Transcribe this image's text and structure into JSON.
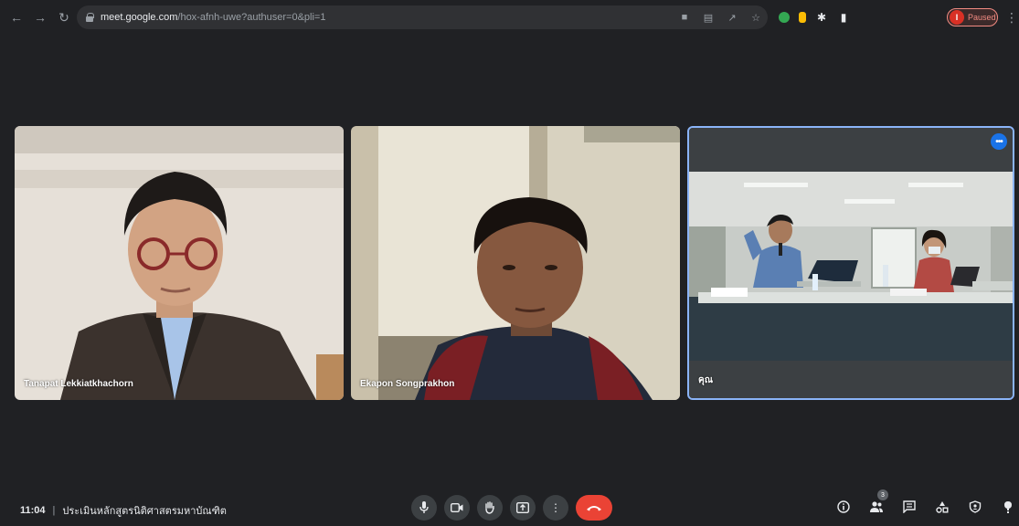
{
  "browser": {
    "url_host": "meet.google.com",
    "url_path": "/hox-afnh-uwe?authuser=0&pli=1",
    "profile_initial": "I",
    "profile_status": "Paused"
  },
  "participants": [
    {
      "name": "Tanapat Lekkiatkhachorn"
    },
    {
      "name": "Ekapon Songprakhon"
    },
    {
      "name": "คุณ"
    }
  ],
  "meeting": {
    "time": "11:04",
    "separator": "|",
    "title": "ประเมินหลักสูตรนิติศาสตรมหาบัณฑิต"
  },
  "people_count": "3",
  "colors": {
    "background": "#202124",
    "end_call": "#ea4335",
    "active_tile_border": "#8ab4f8",
    "more_button": "#1a73e8"
  },
  "icons": {
    "back": "arrow-left-icon",
    "forward": "arrow-right-icon",
    "reload": "reload-icon",
    "mic": "mic-icon",
    "camera": "camera-icon",
    "hand": "raise-hand-icon",
    "present": "present-icon",
    "more": "more-vert-icon",
    "end": "end-call-icon",
    "info": "info-icon",
    "people": "people-icon",
    "chat": "chat-icon",
    "activities": "activities-icon",
    "host": "host-controls-icon",
    "caption": "caption-icon"
  }
}
